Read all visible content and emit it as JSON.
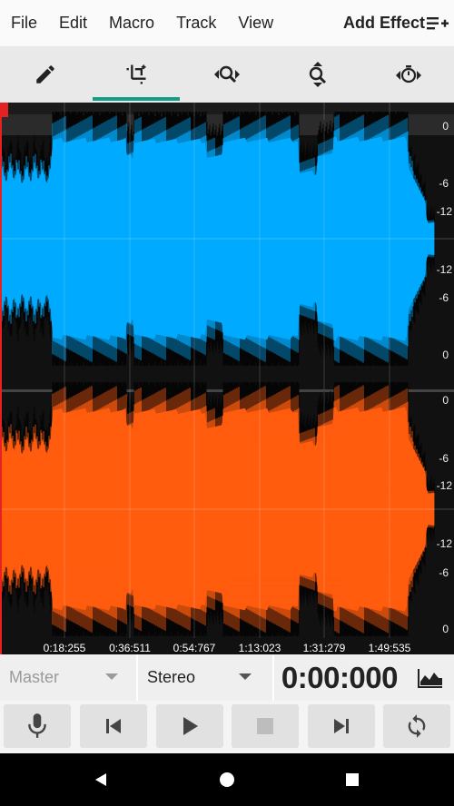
{
  "menu": {
    "items": [
      "File",
      "Edit",
      "Macro",
      "Track",
      "View"
    ],
    "add_effect": "Add Effect"
  },
  "toolbar": {
    "tools": [
      "pencil-icon",
      "crop-icon",
      "zoom-horizontal-icon",
      "zoom-vertical-icon",
      "timer-icon"
    ],
    "active_tool": "crop-icon"
  },
  "waveform": {
    "channel_colors": {
      "top": "#00aaff",
      "bottom": "#ff5c0f"
    },
    "db_labels_top": [
      "0",
      "-6",
      "-12",
      "-12",
      "-6",
      "0"
    ],
    "db_labels_bottom": [
      "0",
      "-6",
      "-12",
      "-12",
      "-6",
      "0"
    ],
    "time_labels": [
      "0:18:255",
      "0:36:511",
      "0:54:767",
      "1:13:023",
      "1:31:279",
      "1:49:535"
    ]
  },
  "controls": {
    "master_label": "Master",
    "channel_mode": "Stereo",
    "time": "0:00:000"
  },
  "transport": {
    "buttons": [
      "mic-icon",
      "skip-back-icon",
      "play-icon",
      "stop-icon",
      "skip-forward-icon",
      "loop-icon"
    ]
  }
}
